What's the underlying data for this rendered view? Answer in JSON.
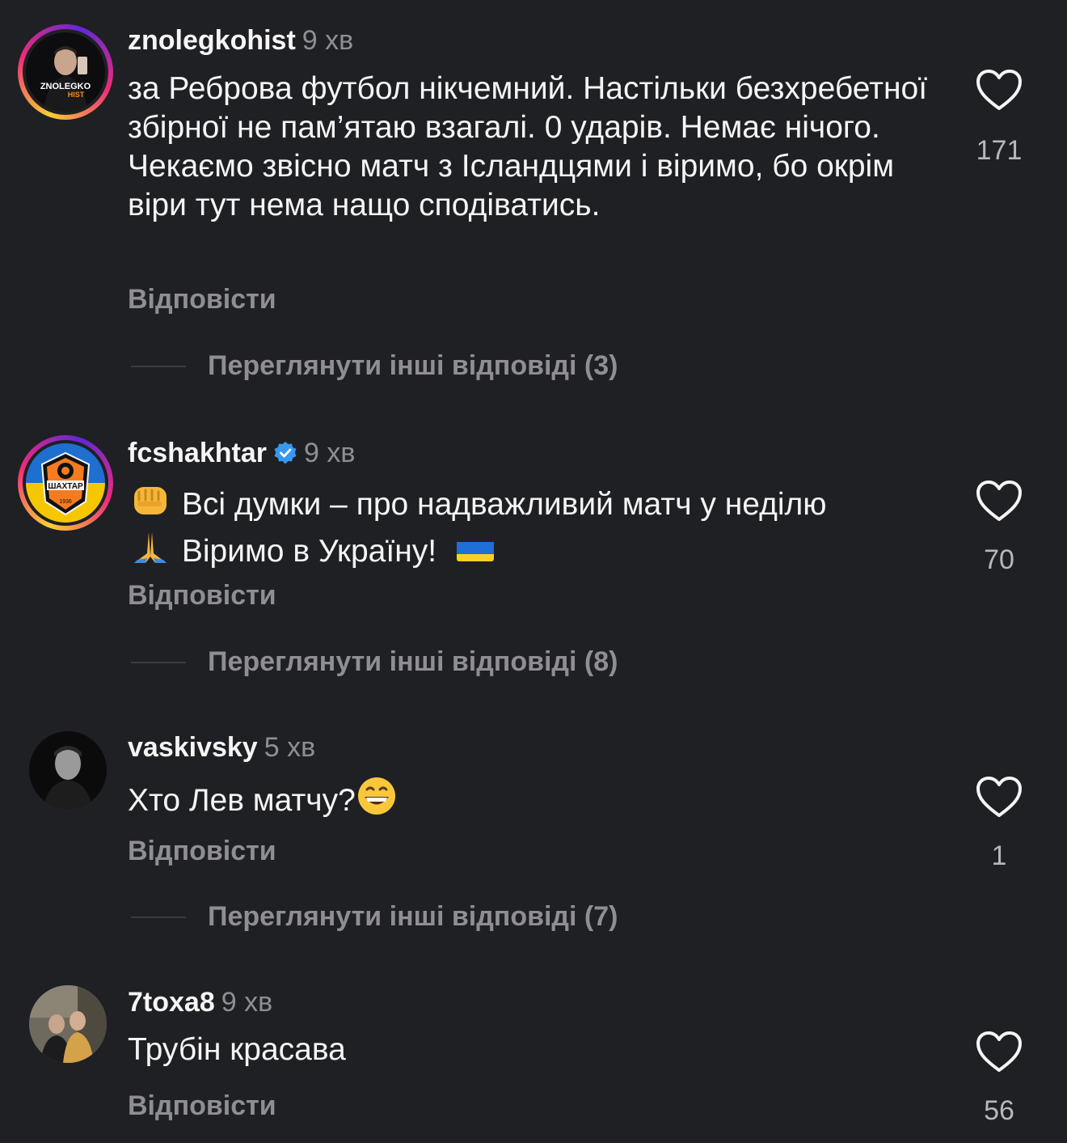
{
  "colors": {
    "background": "#1f2024",
    "primary_text": "#f5f5f5",
    "secondary_text": "#8e8e93",
    "verified_badge": "#3897f0"
  },
  "comments": [
    {
      "username": "znolegkohist",
      "time": "9 хв",
      "text": "за Реброва футбол нікчемний. Настільки безхребетної збірної не пам’ятаю взагалі. 0 ударів. Немає нічого. Чекаємо звісно матч з Ісландцями і віримо, бо окрім віри тут нема нащо сподіватись.",
      "reply_label": "Відповісти",
      "more_replies": "Переглянути інші відповіді (3)",
      "likes": "171",
      "avatar_text_top": "ZNOLEGKO",
      "avatar_text_bottom": "HIST"
    },
    {
      "username": "fcshakhtar",
      "verified": true,
      "time": "9 хв",
      "text_line1": "Всі думки – про надважливий матч у неділю",
      "text_line2": "Віримо в Україну!",
      "reply_label": "Відповісти",
      "more_replies": "Переглянути інші відповіді (8)",
      "likes": "70",
      "avatar_text": "ШАХТАР",
      "avatar_year": "1936"
    },
    {
      "username": "vaskivsky",
      "time": "5 хв",
      "text": "Хто Лев матчу?",
      "reply_label": "Відповісти",
      "more_replies": "Переглянути інші відповіді (7)",
      "likes": "1"
    },
    {
      "username": "7toxa8",
      "time": "9 хв",
      "text": "Трубін красава",
      "reply_label": "Відповісти",
      "likes": "56"
    }
  ],
  "icons": {
    "like": "heart-outline-icon",
    "verified": "verified-badge-icon",
    "emoji_fist": "oncoming-fist-emoji",
    "emoji_pray": "folded-hands-emoji",
    "emoji_smile": "grinning-face-emoji",
    "flag": "ukraine-flag-emoji"
  }
}
